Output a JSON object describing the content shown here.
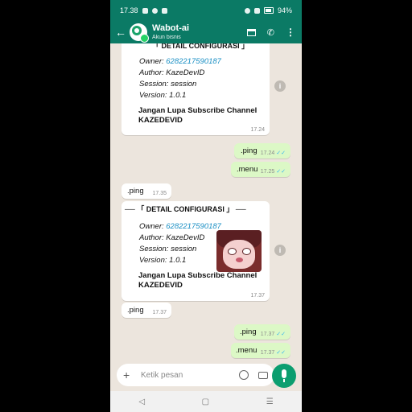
{
  "status": {
    "time": "17.38",
    "battery": "94%"
  },
  "header": {
    "title": "Wabot-ai",
    "subtitle": "Akun bisnis"
  },
  "colors": {
    "header": "#0b7a65",
    "outgoing": "#dcf8c6",
    "incoming": "#ffffff",
    "chat_bg": "#ece5dd",
    "link": "#1a8fc4",
    "read_tick": "#34b7f1",
    "mic": "#0b9e6f"
  },
  "icons": [
    "back-arrow-icon",
    "store-icon",
    "add-call-icon",
    "more-vert-icon",
    "info-icon",
    "plus-icon",
    "emoji-icon",
    "camera-icon",
    "mic-icon"
  ],
  "messages": {
    "detail1": {
      "header": "「 DETAIL CONFIGURASI 」",
      "owner_label": "Owner:",
      "owner_value": "6282217590187",
      "author_label": "Author:",
      "author_value": "KazeDevID",
      "session_label": "Session:",
      "session_value": "session",
      "version_label": "Version:",
      "version_value": "1.0.1",
      "channel_line1": "Jangan Lupa Subscribe Channel",
      "channel_line2": "KAZEDEVID",
      "time": "17.24"
    },
    "out_ping1": {
      "text": ".ping",
      "time": "17.24",
      "tick": "✓✓"
    },
    "out_menu1": {
      "text": ".menu",
      "time": "17.25",
      "tick": "✓✓"
    },
    "in_ping1": {
      "text": ".ping",
      "time": "17.35"
    },
    "detail2": {
      "header": "── 「 DETAIL CONFIGURASI 」 ──",
      "owner_label": "Owner:",
      "owner_value": "6282217590187",
      "author_label": "Author:",
      "author_value": "KazeDevID",
      "session_label": "Session:",
      "session_value": "session",
      "version_label": "Version:",
      "version_value": "1.0.1",
      "channel_line1": "Jangan Lupa Subscribe Channel",
      "channel_line2": "KAZEDEVID",
      "time": "17.37"
    },
    "in_ping2": {
      "text": ".ping",
      "time": "17.37"
    },
    "out_ping2": {
      "text": ".ping",
      "time": "17.37",
      "tick": "✓✓"
    },
    "out_menu2": {
      "text": ".menu",
      "time": "17.37",
      "tick": "✓✓"
    }
  },
  "input": {
    "placeholder": "Ketik pesan"
  },
  "nav": {
    "back": "◁",
    "home": "▢",
    "recents": "☰"
  }
}
